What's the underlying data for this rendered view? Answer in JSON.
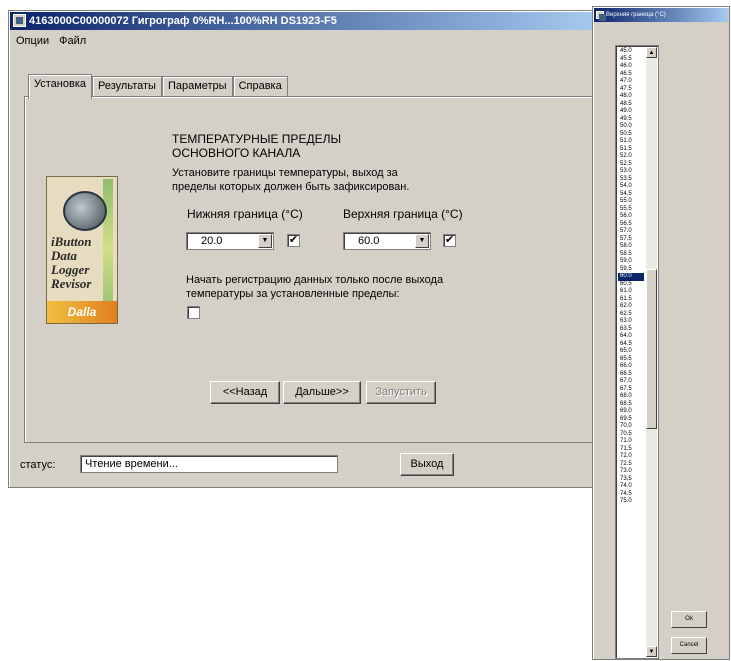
{
  "main_window": {
    "title": "4163000C00000072   Гигрограф 0%RH...100%RH   DS1923-F5",
    "menu": [
      "Опции",
      "Файл"
    ],
    "tabs": [
      "Установка",
      "Результаты",
      "Параметры",
      "Справка"
    ],
    "active_tab": 0,
    "logo": {
      "line1": "iButton",
      "line2": "Data",
      "line3": "Logger",
      "line4": "Revisor",
      "brand": "Dalla"
    },
    "section": {
      "heading1": "ТЕМПЕРАТУРНЫЕ ПРЕДЕЛЫ",
      "heading2": "ОСНОВНОГО КАНАЛА",
      "desc1": "Установите границы температуры, выход за",
      "desc2": "пределы которых должен быть зафиксирован.",
      "lower_label": "Нижняя граница (°C)",
      "upper_label": "Верхняя граница (°C)",
      "lower_value": "20.0",
      "upper_value": "60.0",
      "lower_checked": true,
      "upper_checked": true,
      "start_text1": "Начать регистрацию данных  только после выхода",
      "start_text2": "температуры за установленные пределы:",
      "start_checked": false
    },
    "buttons": {
      "back": "<<Назад",
      "next": "Дальше>>",
      "start": "Запустить"
    },
    "status": {
      "label": "статус:",
      "value": "Чтение времени...",
      "exit": "Выход"
    }
  },
  "list_window": {
    "title": "Верхняя граница (°C)",
    "items": [
      "45.0",
      "45.5",
      "46.0",
      "46.5",
      "47.0",
      "47.5",
      "48.0",
      "48.5",
      "49.0",
      "49.5",
      "50.0",
      "50.5",
      "51.0",
      "51.5",
      "52.0",
      "52.5",
      "53.0",
      "53.5",
      "54.0",
      "54.5",
      "55.0",
      "55.5",
      "56.0",
      "56.5",
      "57.0",
      "57.5",
      "58.0",
      "58.5",
      "59.0",
      "59.5",
      "60.0",
      "60.5",
      "61.0",
      "61.5",
      "62.0",
      "62.5",
      "63.0",
      "63.5",
      "64.0",
      "64.5",
      "65.0",
      "65.5",
      "66.0",
      "66.5",
      "67.0",
      "67.5",
      "68.0",
      "68.5",
      "69.0",
      "69.5",
      "70.0",
      "70.5",
      "71.0",
      "71.5",
      "72.0",
      "72.5",
      "73.0",
      "73.5",
      "74.0",
      "74.5",
      "75.0"
    ],
    "selected": "60.0",
    "ok": "Ok",
    "cancel": "Cancel"
  },
  "icons": {
    "scroll_up": "arrow-up-icon",
    "scroll_down": "arrow-down-icon",
    "dropdown": "chevron-down-icon"
  },
  "colors": {
    "title_start": "#0a246a",
    "title_end": "#a6caf0",
    "face": "#d4d0c8",
    "selection": "#0a246a"
  }
}
